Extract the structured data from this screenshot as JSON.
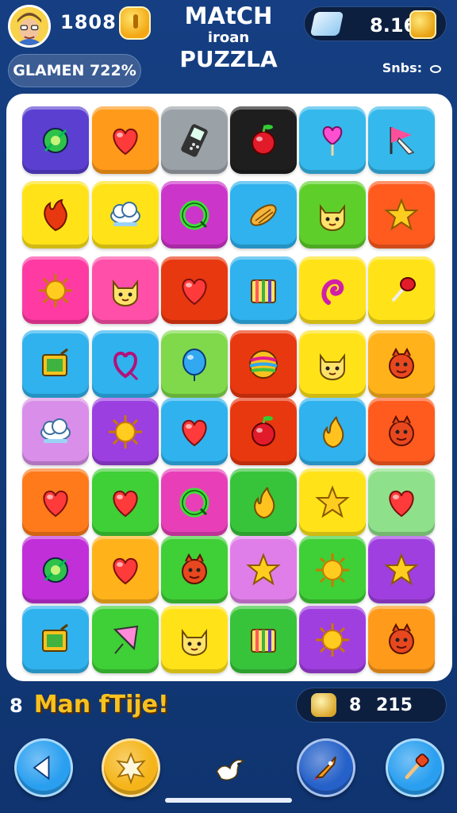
{
  "header": {
    "player_score": "1808",
    "title_line1": "MAtCH",
    "title_line2": "iroan",
    "title_line3": "PUZZLA",
    "currency_value": "8.16",
    "progress_label": "GLAMEN 722%",
    "stats_label": "Snbs:"
  },
  "board": {
    "rows": [
      [
        {
          "color": "#5a3fd1",
          "icon": "leaf-icon"
        },
        {
          "color": "#ff9a1a",
          "icon": "heart-icon"
        },
        {
          "color": "#9aa2a8",
          "icon": "phone-icon"
        },
        {
          "color": "#1e1e1e",
          "icon": "apple-icon"
        },
        {
          "color": "#35b8ec",
          "icon": "heart-lollipop-icon"
        },
        {
          "color": "#35b8ec",
          "icon": "flag-icon"
        }
      ],
      [
        {
          "color": "#ffe318",
          "icon": "flame-heart-icon"
        },
        {
          "color": "#ffe318",
          "icon": "cloud-icon"
        },
        {
          "color": "#cc35c9",
          "icon": "ring-icon"
        },
        {
          "color": "#2fb2ee",
          "icon": "candy-icon"
        },
        {
          "color": "#5ecf2a",
          "icon": "cat-face-icon"
        },
        {
          "color": "#ff5b1f",
          "icon": "star-icon"
        }
      ],
      [
        {
          "color": "#ff3aa3",
          "icon": "sun-icon"
        },
        {
          "color": "#ff4fa8",
          "icon": "cat-face-icon"
        },
        {
          "color": "#e8380f",
          "icon": "heart-icon"
        },
        {
          "color": "#2fb2ee",
          "icon": "gift-stripes-icon"
        },
        {
          "color": "#ffe318",
          "icon": "swirl-icon"
        },
        {
          "color": "#ffe318",
          "icon": "lollipop-icon"
        }
      ],
      [
        {
          "color": "#2fb2ee",
          "icon": "photo-icon"
        },
        {
          "color": "#2fb2ee",
          "icon": "heart-outline-icon"
        },
        {
          "color": "#7fd94a",
          "icon": "balloon-icon"
        },
        {
          "color": "#e8380f",
          "icon": "ball-icon"
        },
        {
          "color": "#ffe318",
          "icon": "cat-face-icon"
        },
        {
          "color": "#ffb21a",
          "icon": "monster-icon"
        }
      ],
      [
        {
          "color": "#d98ee9",
          "icon": "cloud-icon"
        },
        {
          "color": "#9b3fe0",
          "icon": "sun-icon"
        },
        {
          "color": "#2fb2ee",
          "icon": "heart-icon"
        },
        {
          "color": "#e8380f",
          "icon": "apple-icon"
        },
        {
          "color": "#2fb2ee",
          "icon": "flame-icon"
        },
        {
          "color": "#ff5b1f",
          "icon": "monster-icon"
        }
      ],
      [
        {
          "color": "#ff7a1a",
          "icon": "heart-icon"
        },
        {
          "color": "#3fcf36",
          "icon": "heart-icon"
        },
        {
          "color": "#e83fb8",
          "icon": "ring-icon"
        },
        {
          "color": "#37c43a",
          "icon": "flame-icon"
        },
        {
          "color": "#ffe318",
          "icon": "star-icon"
        },
        {
          "color": "#8fe08a",
          "icon": "heart-icon"
        }
      ],
      [
        {
          "color": "#c12fd9",
          "icon": "leaf-icon"
        },
        {
          "color": "#ffb21a",
          "icon": "heart-icon"
        },
        {
          "color": "#3fcf36",
          "icon": "monster-icon"
        },
        {
          "color": "#e07ee9",
          "icon": "star-icon"
        },
        {
          "color": "#3fcf36",
          "icon": "sun-icon"
        },
        {
          "color": "#a03fe0",
          "icon": "star-icon"
        }
      ],
      [
        {
          "color": "#2fb2ee",
          "icon": "photo-icon"
        },
        {
          "color": "#3fcf36",
          "icon": "kite-icon"
        },
        {
          "color": "#ffe318",
          "icon": "cat-face-icon"
        },
        {
          "color": "#37c43a",
          "icon": "gift-stripes-icon"
        },
        {
          "color": "#a03fe0",
          "icon": "sun-icon"
        },
        {
          "color": "#ff9a1a",
          "icon": "monster-icon"
        }
      ]
    ]
  },
  "footer": {
    "level_number": "8",
    "level_text": "Man fTije!",
    "score_prefix": "8",
    "score_value": "215",
    "buttons": [
      {
        "name": "back-button",
        "icon": "play-left-icon",
        "color": "#2a9ff0"
      },
      {
        "name": "star-button",
        "icon": "star-burst-icon",
        "color": "#f5b51a"
      },
      {
        "name": "bird-button",
        "icon": "bird-icon",
        "color": "transparent"
      },
      {
        "name": "rocket-button",
        "icon": "rocket-icon",
        "color": "#2561c9"
      },
      {
        "name": "hammer-button",
        "icon": "hammer-icon",
        "color": "#2a9ff0"
      }
    ]
  }
}
